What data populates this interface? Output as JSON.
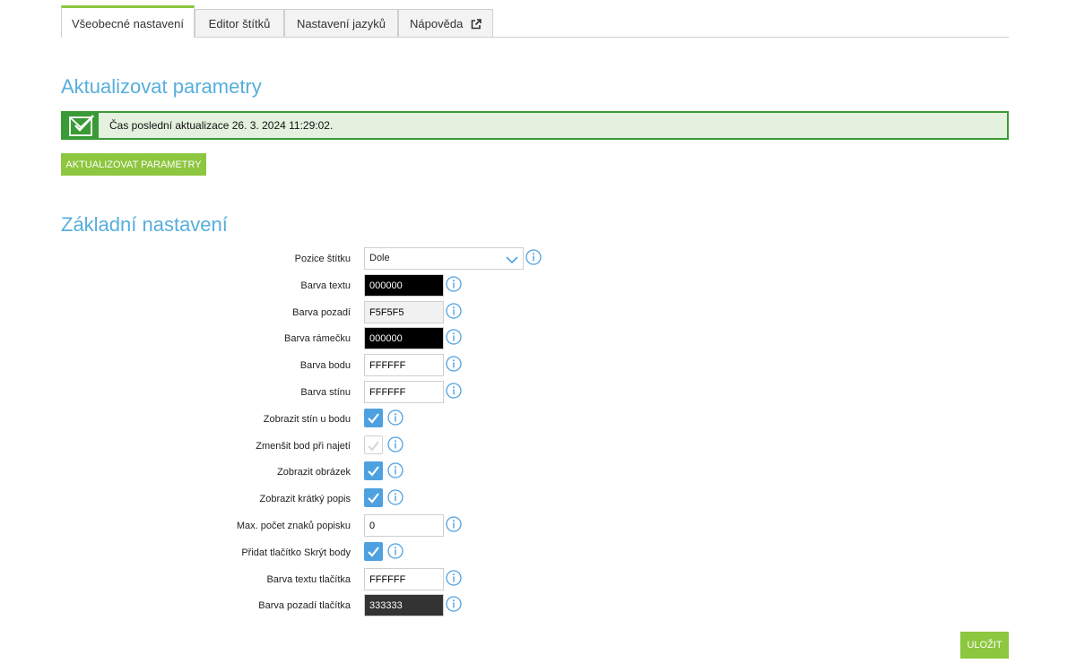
{
  "tabs": [
    {
      "label": "Všeobecné nastavení",
      "active": true
    },
    {
      "label": "Editor štítků",
      "active": false
    },
    {
      "label": "Nastavení jazyků",
      "active": false
    },
    {
      "label": "Nápověda",
      "active": false,
      "icon": "external-link-icon"
    }
  ],
  "update_section": {
    "title": "Aktualizovat parametry",
    "notice": {
      "icon": "envelope-check-icon",
      "text": "Čas poslední aktualizace 26. 3. 2024 11:29:02."
    },
    "button_label": "AKTUALIZOVAT PARAMETRY"
  },
  "basic_section": {
    "title": "Základní nastavení",
    "fields": [
      {
        "label": "Pozice štítku",
        "type": "select",
        "value": "Dole"
      },
      {
        "label": "Barva textu",
        "type": "color",
        "value": "000000",
        "bg": "#000000",
        "fg": "#ffffff"
      },
      {
        "label": "Barva pozadí",
        "type": "color",
        "value": "F5F5F5",
        "bg": "#f5f5f5",
        "fg": "#000000"
      },
      {
        "label": "Barva rámečku",
        "type": "color",
        "value": "000000",
        "bg": "#000000",
        "fg": "#ffffff"
      },
      {
        "label": "Barva bodu",
        "type": "color",
        "value": "FFFFFF",
        "bg": "#ffffff",
        "fg": "#000000"
      },
      {
        "label": "Barva stínu",
        "type": "color",
        "value": "FFFFFF",
        "bg": "#ffffff",
        "fg": "#000000"
      },
      {
        "label": "Zobrazit stín u bodu",
        "type": "checkbox",
        "checked": true
      },
      {
        "label": "Zmenšit bod při najetí",
        "type": "checkbox",
        "checked": false
      },
      {
        "label": "Zobrazit obrázek",
        "type": "checkbox",
        "checked": true
      },
      {
        "label": "Zobrazit krátký popis",
        "type": "checkbox",
        "checked": true
      },
      {
        "label": "Max. počet znaků popisku",
        "type": "number",
        "value": "0"
      },
      {
        "label": "Přidat tlačítko Skrýt body",
        "type": "checkbox",
        "checked": true
      },
      {
        "label": "Barva textu tlačítka",
        "type": "color",
        "value": "FFFFFF",
        "bg": "#ffffff",
        "fg": "#000000"
      },
      {
        "label": "Barva pozadí tlačítka",
        "type": "color",
        "value": "333333",
        "bg": "#333333",
        "fg": "#ffffff"
      }
    ],
    "info_icon": "info-icon",
    "save_label": "ULOŽIT"
  },
  "colors": {
    "accent_green": "#8dc63f",
    "notice_green": "#3a9a36",
    "heading_blue": "#56aedc",
    "checkbox_blue": "#4ea1e0"
  }
}
